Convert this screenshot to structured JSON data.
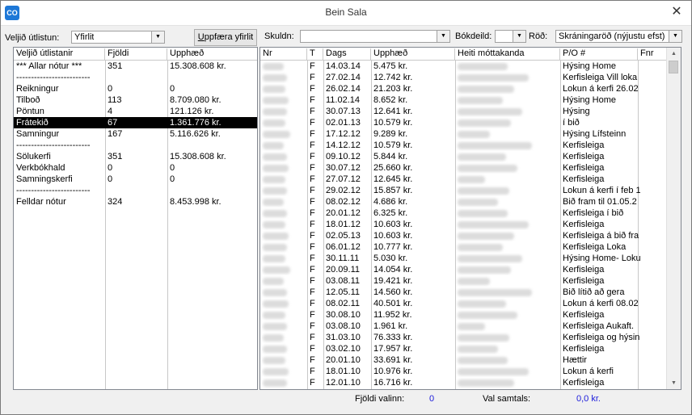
{
  "window": {
    "title": "Bein Sala",
    "app_icon_text": "CO",
    "close_glyph": "✕"
  },
  "toolbar": {
    "view_label": "Veljið útlistun:",
    "view_value": "Yfirlit",
    "update_label_underlined": "U",
    "update_label_rest": "ppfæra yfirlit",
    "debtor_label": "Skuldn:",
    "debtor_value": "",
    "ledger_label": "Bókdeild:",
    "ledger_value": "",
    "order_label": "Röð:",
    "order_value": "Skráningaröð (nýjustu efst)"
  },
  "summary": {
    "headers": [
      "Veljið útlistanir",
      "Fjöldi",
      "Upphæð"
    ],
    "rows": [
      {
        "name": "*** Allar nótur ***",
        "count": "351",
        "amount": "15.308.608 kr."
      },
      {
        "name": "-------------------------",
        "count": "",
        "amount": ""
      },
      {
        "name": "Reikningur",
        "count": "0",
        "amount": "0"
      },
      {
        "name": "Tilboð",
        "count": "113",
        "amount": "8.709.080 kr."
      },
      {
        "name": "Pöntun",
        "count": "4",
        "amount": "121.126 kr."
      },
      {
        "name": "Frátekið",
        "count": "67",
        "amount": "1.361.776 kr.",
        "selected": true
      },
      {
        "name": "Samningur",
        "count": "167",
        "amount": "5.116.626 kr."
      },
      {
        "name": "-------------------------",
        "count": "",
        "amount": ""
      },
      {
        "name": "Sölukerfi",
        "count": "351",
        "amount": "15.308.608 kr."
      },
      {
        "name": "Verkbókhald",
        "count": "0",
        "amount": "0"
      },
      {
        "name": "Samningskerfi",
        "count": "0",
        "amount": "0"
      },
      {
        "name": "-------------------------",
        "count": "",
        "amount": ""
      },
      {
        "name": "Felldar nótur",
        "count": "324",
        "amount": "8.453.998 kr."
      }
    ]
  },
  "invoices": {
    "headers": [
      "Nr",
      "T",
      "Dags",
      "Upphæð",
      "Heiti móttakanda",
      "P/O #",
      "Fnr"
    ],
    "rows": [
      {
        "t": "F",
        "date": "14.03.14",
        "amount": "5.475 kr.",
        "po": "Hýsing Home"
      },
      {
        "t": "F",
        "date": "27.02.14",
        "amount": "12.742 kr.",
        "po": "Kerfisleiga Vill loka"
      },
      {
        "t": "F",
        "date": "26.02.14",
        "amount": "21.203 kr.",
        "po": "Lokun á kerfi 26.02"
      },
      {
        "t": "F",
        "date": "11.02.14",
        "amount": "8.652 kr.",
        "po": "Hýsing Home"
      },
      {
        "t": "F",
        "date": "30.07.13",
        "amount": "12.641 kr.",
        "po": "Hýsing"
      },
      {
        "t": "F",
        "date": "02.01.13",
        "amount": "10.579 kr.",
        "po": "í bið"
      },
      {
        "t": "F",
        "date": "17.12.12",
        "amount": "9.289 kr.",
        "po": "Hýsing Lífsteinn"
      },
      {
        "t": "F",
        "date": "14.12.12",
        "amount": "10.579 kr.",
        "po": "Kerfisleiga"
      },
      {
        "t": "F",
        "date": "09.10.12",
        "amount": "5.844 kr.",
        "po": "Kerfisleiga"
      },
      {
        "t": "F",
        "date": "30.07.12",
        "amount": "25.660 kr.",
        "po": "Kerfisleiga"
      },
      {
        "t": "F",
        "date": "27.07.12",
        "amount": "12.645 kr.",
        "po": "Kerfisleiga"
      },
      {
        "t": "F",
        "date": "29.02.12",
        "amount": "15.857 kr.",
        "po": "Lokun á kerfi í feb 1"
      },
      {
        "t": "F",
        "date": "08.02.12",
        "amount": "4.686 kr.",
        "po": "Bið fram til 01.05.2"
      },
      {
        "t": "F",
        "date": "20.01.12",
        "amount": "6.325 kr.",
        "po": "Kerfisleiga í bið"
      },
      {
        "t": "F",
        "date": "18.01.12",
        "amount": "10.603 kr.",
        "po": "Kerfisleiga"
      },
      {
        "t": "F",
        "date": "02.05.13",
        "amount": "10.603 kr.",
        "po": "Kerfisleiga á bið fra"
      },
      {
        "t": "F",
        "date": "06.01.12",
        "amount": "10.777 kr.",
        "po": "Kerfisleiga Loka"
      },
      {
        "t": "F",
        "date": "30.11.11",
        "amount": "5.030 kr.",
        "po": "Hýsing Home- Loku"
      },
      {
        "t": "F",
        "date": "20.09.11",
        "amount": "14.054 kr.",
        "po": "Kerfisleiga"
      },
      {
        "t": "F",
        "date": "03.08.11",
        "amount": "19.421 kr.",
        "po": "Kerfisleiga"
      },
      {
        "t": "F",
        "date": "12.05.11",
        "amount": "14.560 kr.",
        "po": "Bið lítið að gera"
      },
      {
        "t": "F",
        "date": "08.02.11",
        "amount": "40.501 kr.",
        "po": "Lokun á kerfi 08.02"
      },
      {
        "t": "F",
        "date": "30.08.10",
        "amount": "11.952 kr.",
        "po": "Kerfisleiga"
      },
      {
        "t": "F",
        "date": "03.08.10",
        "amount": "1.961 kr.",
        "po": "Kerfisleiga Aukaft."
      },
      {
        "t": "F",
        "date": "31.03.10",
        "amount": "76.333 kr.",
        "po": "Kerfisleiga og hýsin"
      },
      {
        "t": "F",
        "date": "03.02.10",
        "amount": "17.957 kr.",
        "po": "Kerfisleiga"
      },
      {
        "t": "F",
        "date": "20.01.10",
        "amount": "33.691 kr.",
        "po": "Hættir"
      },
      {
        "t": "F",
        "date": "18.01.10",
        "amount": "10.976 kr.",
        "po": "Lokun á kerfi"
      },
      {
        "t": "F",
        "date": "12.01.10",
        "amount": "16.716 kr.",
        "po": "Kerfisleiga"
      }
    ]
  },
  "footer": {
    "selected_count_label": "Fjöldi valinn:",
    "selected_count_value": "0",
    "selected_total_label": "Val samtals:",
    "selected_total_value": "0,0 kr."
  },
  "colors": {
    "selection_bg": "#000000",
    "footer_value": "#1a1adb"
  }
}
